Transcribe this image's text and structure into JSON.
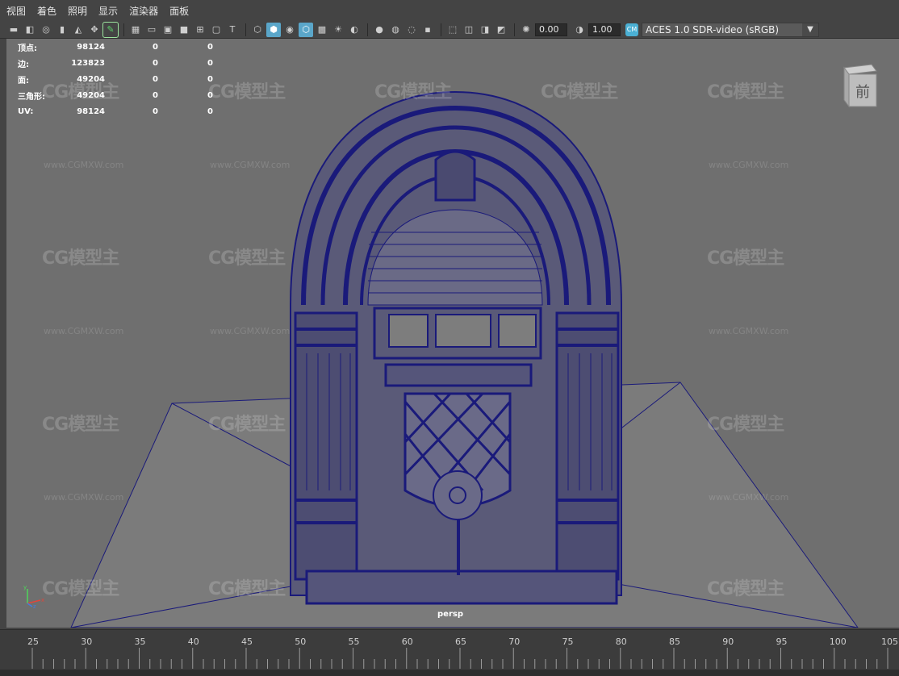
{
  "menu": [
    "视图",
    "着色",
    "照明",
    "显示",
    "渲染器",
    "面板"
  ],
  "toolbar": {
    "exposure_value": "0.00",
    "gamma_value": "1.00",
    "color_space_badge": "CM",
    "color_space": "ACES 1.0 SDR-video (sRGB)"
  },
  "hud": {
    "rows": [
      {
        "label": "顶点:",
        "v1": "98124",
        "v2": "0",
        "v3": "0"
      },
      {
        "label": "边:",
        "v1": "123823",
        "v2": "0",
        "v3": "0"
      },
      {
        "label": "面:",
        "v1": "49204",
        "v2": "0",
        "v3": "0"
      },
      {
        "label": "三角形:",
        "v1": "49204",
        "v2": "0",
        "v3": "0"
      },
      {
        "label": "UV:",
        "v1": "98124",
        "v2": "0",
        "v3": "0"
      }
    ]
  },
  "viewcube": {
    "face_label": "前"
  },
  "camera_label": "persp",
  "watermark": {
    "logo": "CG模型主",
    "url": "www.CGMXW.com"
  },
  "axis": {
    "y": "y",
    "x": "x",
    "z": "z"
  },
  "timeline": {
    "ticks": [
      "25",
      "30",
      "35",
      "40",
      "45",
      "50",
      "55",
      "60",
      "65",
      "70",
      "75",
      "80",
      "85",
      "90",
      "95",
      "100",
      "105"
    ]
  },
  "colors": {
    "wireframe": "#1a1a7a",
    "viewport_bg": "#6f6f6f",
    "ground": "#7b7b7b"
  }
}
